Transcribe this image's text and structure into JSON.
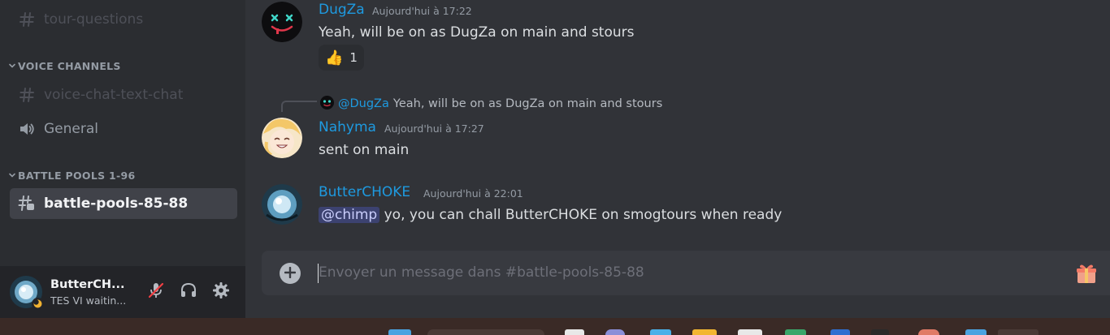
{
  "sidebar": {
    "channels_top": [
      {
        "label": "tour-questions",
        "icon": "hash-icon"
      }
    ],
    "categories": [
      {
        "label": "VOICE CHANNELS",
        "channels": [
          {
            "label": "voice-chat-text-chat",
            "icon": "hash-icon"
          },
          {
            "label": "General",
            "icon": "speaker-icon"
          }
        ]
      },
      {
        "label": "BATTLE POOLS 1-96",
        "channels": [
          {
            "label": "battle-pools-85-88",
            "icon": "hash-thread-icon",
            "active": true
          }
        ]
      }
    ]
  },
  "user_panel": {
    "name": "ButterCH...",
    "status": "TES VI waitin...",
    "icons": [
      "mic-muted-icon",
      "headphones-icon",
      "gear-icon"
    ],
    "status_color": "#f0b232"
  },
  "messages": [
    {
      "author": "DugZa",
      "timestamp": "Aujourd'hui à 17:22",
      "text": "Yeah, will be on as DugZa on main and stours",
      "reaction": {
        "emoji": "👍",
        "count": "1"
      }
    },
    {
      "reply_to": {
        "author": "@DugZa",
        "text": "Yeah, will be on as DugZa on main and stours"
      },
      "author": "Nahyma",
      "timestamp": "Aujourd'hui à 17:27",
      "text": "sent on main"
    },
    {
      "author": "ButterCHOKE",
      "timestamp": "Aujourd'hui à 22:01",
      "mention": "@chimp",
      "text": " yo, you can chall ButterCHOKE on smogtours when ready"
    }
  ],
  "composer": {
    "placeholder": "Envoyer un message dans #battle-pools-85-88"
  },
  "colors": {
    "accent_author": "#1e9ae0",
    "background": "#313338",
    "sidebar": "#2b2d31"
  }
}
